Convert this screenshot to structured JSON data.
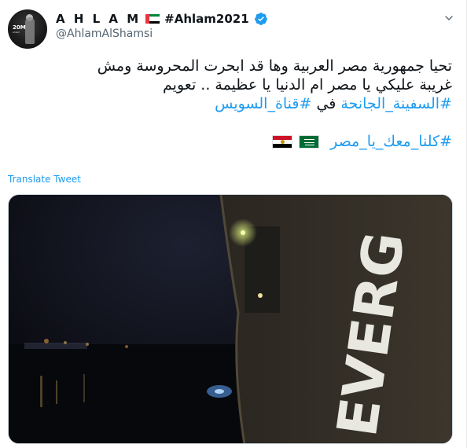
{
  "user": {
    "display_name": "A H L A M",
    "display_hashtag": "#Ahlam2021",
    "handle": "@AhlamAlShamsi",
    "avatar_text": "20M",
    "avatar_subtext": "ahlam"
  },
  "tweet": {
    "line1": "تحيا جمهورية مصر العربية وها قد ابحرت المحروسة ومش",
    "line2": "غريبة عليكي يا مصر ام الدنيا يا عظيمة .. تعويم",
    "line3_link1": "#السفينة_الجانحة",
    "line3_mid": " في ",
    "line3_link2": "#قناة_السويس",
    "line4_link": "#كلنا_معك_يا_مصر",
    "flags": [
      "saudi-flag",
      "egypt-flag"
    ]
  },
  "translate_label": "Translate Tweet",
  "media": {
    "ship_lettering": "EVERG"
  },
  "colors": {
    "link": "#1d9bf0",
    "verified": "#1d9bf0",
    "text": "#0f1419",
    "secondary": "#536471"
  }
}
